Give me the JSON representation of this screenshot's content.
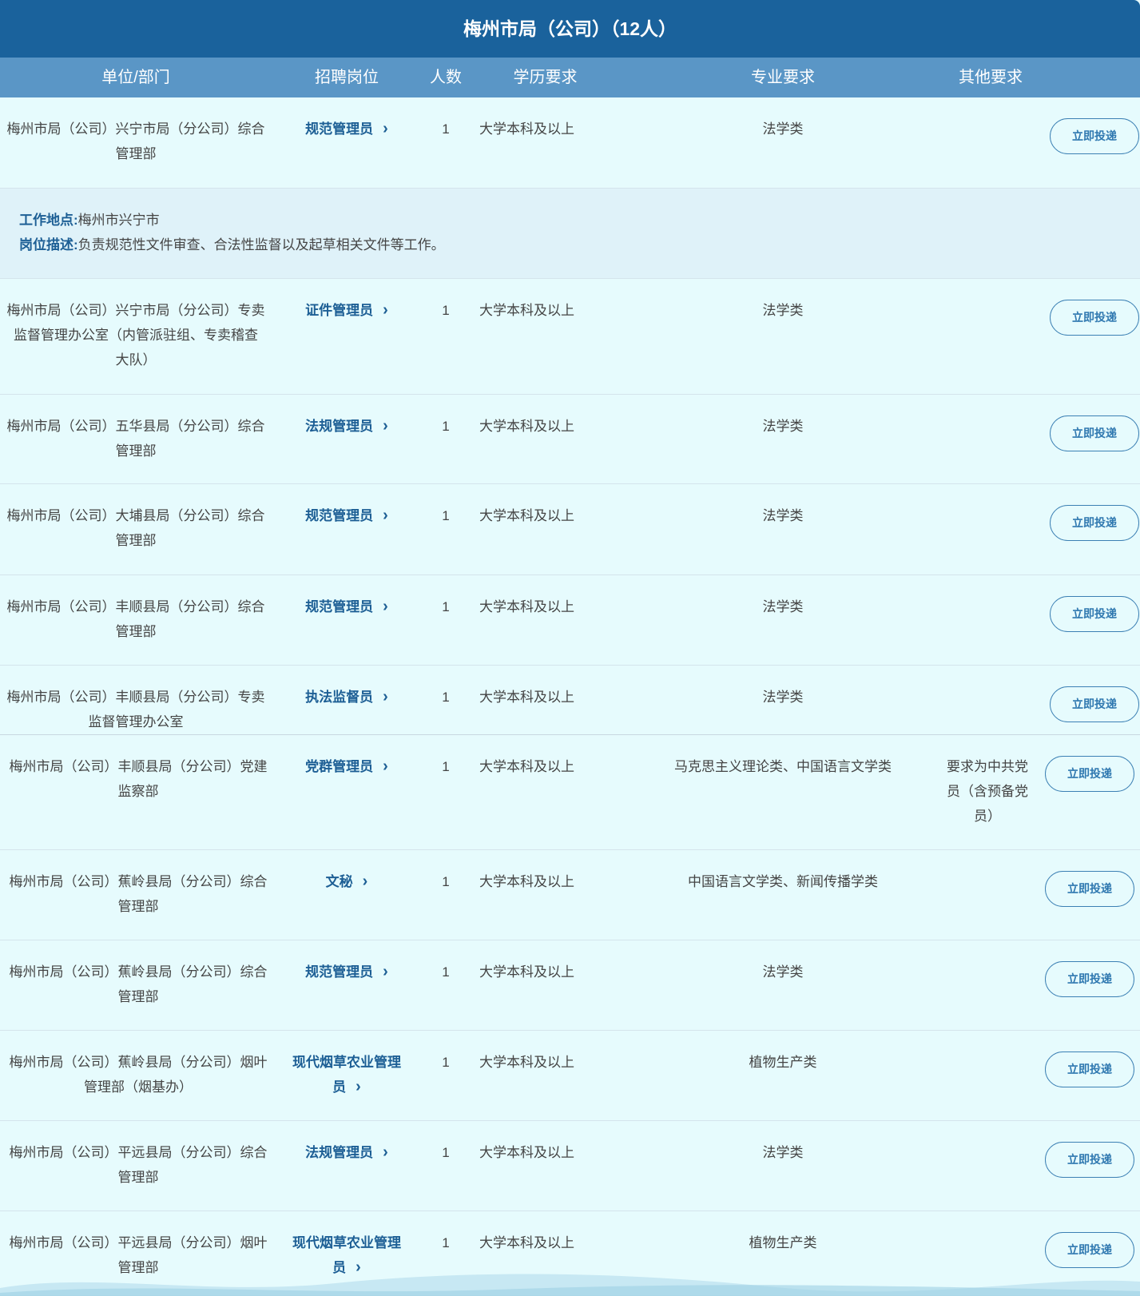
{
  "title": "梅州市局（公司）（12人）",
  "columns": {
    "unit": "单位/部门",
    "post": "招聘岗位",
    "count": "人数",
    "edu": "学历要求",
    "major": "专业要求",
    "other": "其他要求"
  },
  "apply_label": "立即投递",
  "detail": {
    "location_key": "工作地点:",
    "location_value": "梅州市兴宁市",
    "desc_key": "岗位描述:",
    "desc_value": "负责规范性文件审查、合法性监督以及起草相关文件等工作。"
  },
  "rows": [
    {
      "unit_lines": [
        "梅州市局（公司）兴宁市局（分公司）综合",
        "管理部"
      ],
      "post_lines": [
        "规范管理员"
      ],
      "count": "1",
      "edu": "大学本科及以上",
      "major": "法学类",
      "other_lines": []
    },
    {
      "unit_lines": [
        "梅州市局（公司）兴宁市局（分公司）专卖",
        "监督管理办公室（内管派驻组、专卖稽查",
        "大队）"
      ],
      "post_lines": [
        "证件管理员"
      ],
      "count": "1",
      "edu": "大学本科及以上",
      "major": "法学类",
      "other_lines": []
    },
    {
      "unit_lines": [
        "梅州市局（公司）五华县局（分公司）综合",
        "管理部"
      ],
      "post_lines": [
        "法规管理员"
      ],
      "count": "1",
      "edu": "大学本科及以上",
      "major": "法学类",
      "other_lines": []
    },
    {
      "unit_lines": [
        "梅州市局（公司）大埔县局（分公司）综合",
        "管理部"
      ],
      "post_lines": [
        "规范管理员"
      ],
      "count": "1",
      "edu": "大学本科及以上",
      "major": "法学类",
      "other_lines": []
    },
    {
      "unit_lines": [
        "梅州市局（公司）丰顺县局（分公司）综合",
        "管理部"
      ],
      "post_lines": [
        "规范管理员"
      ],
      "count": "1",
      "edu": "大学本科及以上",
      "major": "法学类",
      "other_lines": []
    },
    {
      "unit_lines": [
        "梅州市局（公司）丰顺县局（分公司）专卖",
        "监督管理办公室"
      ],
      "post_lines": [
        "执法监督员"
      ],
      "count": "1",
      "edu": "大学本科及以上",
      "major": "法学类",
      "other_lines": []
    },
    {
      "unit_lines": [
        "梅州市局（公司）丰顺县局（分公司）党建",
        "监察部"
      ],
      "post_lines": [
        "党群管理员"
      ],
      "count": "1",
      "edu": "大学本科及以上",
      "major": "马克思主义理论类、中国语言文学类",
      "other_lines": [
        "要求为中共党",
        "员（含预备党",
        "员）"
      ]
    },
    {
      "unit_lines": [
        "梅州市局（公司）蕉岭县局（分公司）综合",
        "管理部"
      ],
      "post_lines": [
        "文秘"
      ],
      "count": "1",
      "edu": "大学本科及以上",
      "major": "中国语言文学类、新闻传播学类",
      "other_lines": []
    },
    {
      "unit_lines": [
        "梅州市局（公司）蕉岭县局（分公司）综合",
        "管理部"
      ],
      "post_lines": [
        "规范管理员"
      ],
      "count": "1",
      "edu": "大学本科及以上",
      "major": "法学类",
      "other_lines": []
    },
    {
      "unit_lines": [
        "梅州市局（公司）蕉岭县局（分公司）烟叶",
        "管理部（烟基办）"
      ],
      "post_lines": [
        "现代烟草农业管理",
        "员"
      ],
      "count": "1",
      "edu": "大学本科及以上",
      "major": "植物生产类",
      "other_lines": []
    },
    {
      "unit_lines": [
        "梅州市局（公司）平远县局（分公司）综合",
        "管理部"
      ],
      "post_lines": [
        "法规管理员"
      ],
      "count": "1",
      "edu": "大学本科及以上",
      "major": "法学类",
      "other_lines": []
    },
    {
      "unit_lines": [
        "梅州市局（公司）平远县局（分公司）烟叶",
        "管理部"
      ],
      "post_lines": [
        "现代烟草农业管理",
        "员"
      ],
      "count": "1",
      "edu": "大学本科及以上",
      "major": "植物生产类",
      "other_lines": []
    }
  ]
}
